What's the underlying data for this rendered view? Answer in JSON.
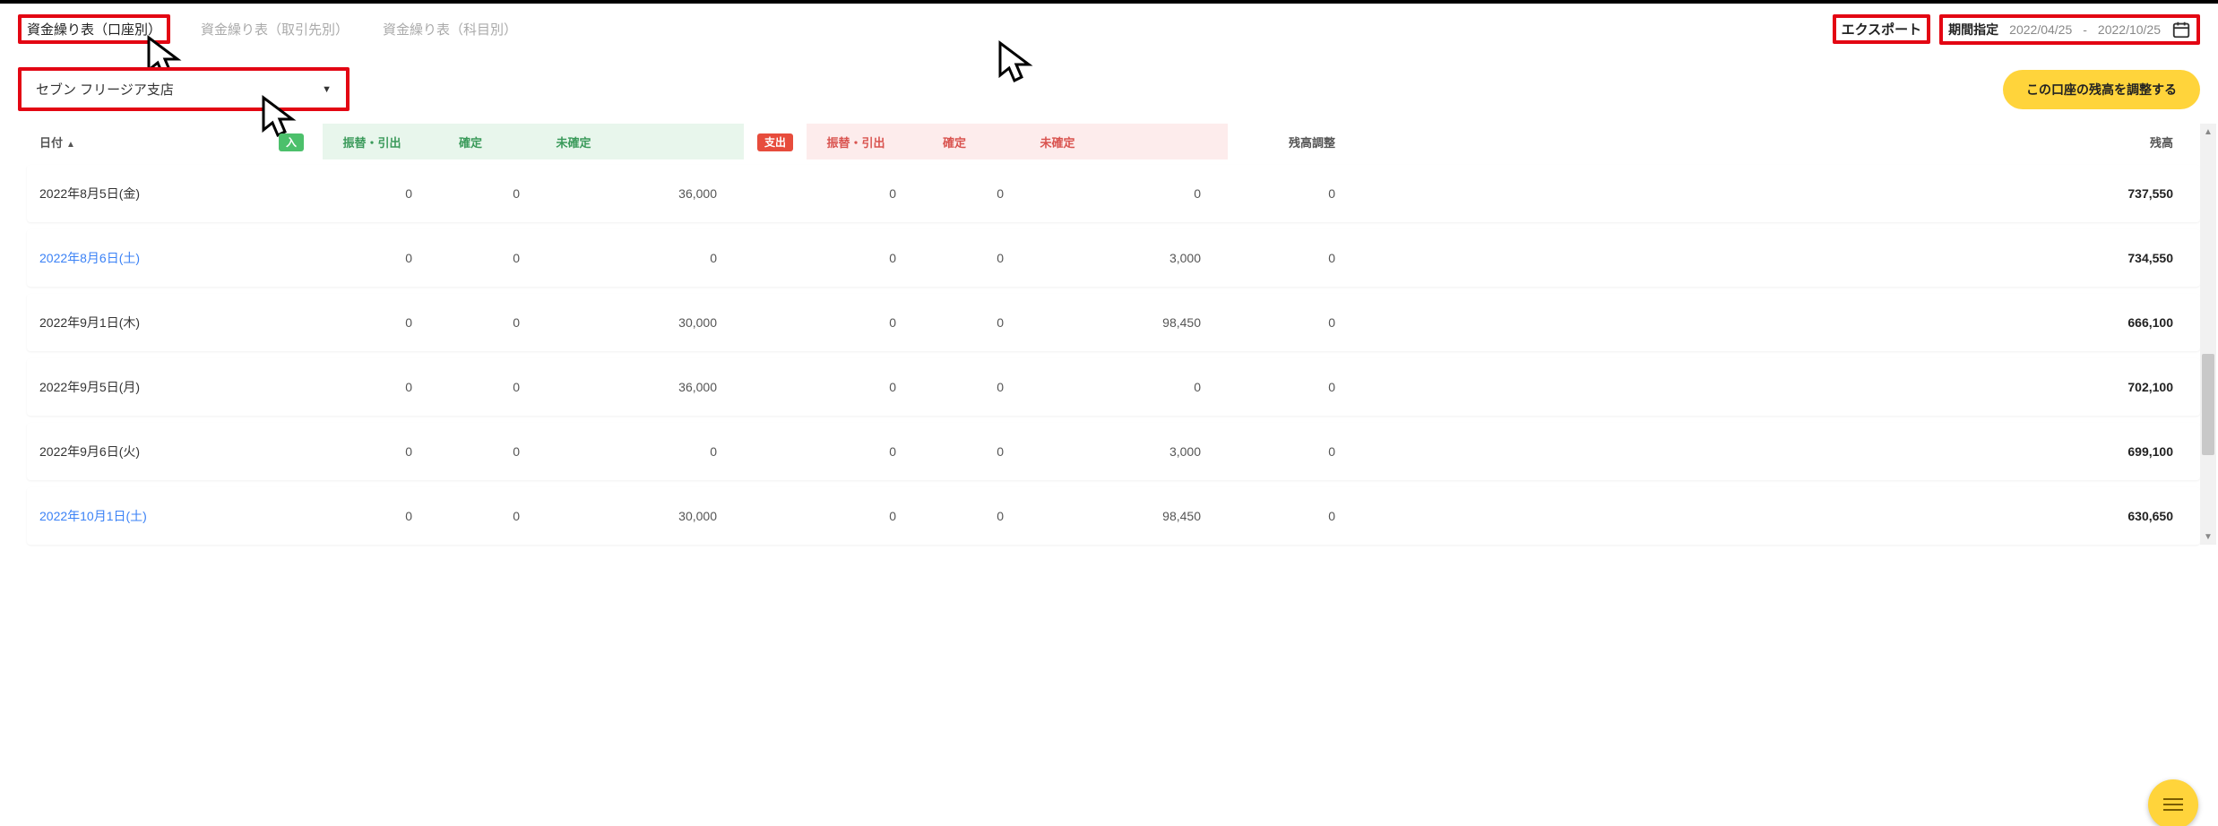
{
  "tabs": {
    "byAccount": "資金繰り表（口座別）",
    "byPartner": "資金繰り表（取引先別）",
    "byItem": "資金繰り表（科目別）"
  },
  "export_label": "エクスポート",
  "period": {
    "label": "期間指定",
    "from": "2022/04/25",
    "sep": "-",
    "to": "2022/10/25"
  },
  "account_selected": "セブン フリージア支店",
  "adjust_balance_label": "この口座の残高を調整する",
  "columns": {
    "date": "日付",
    "badge_in": "入",
    "in_transfer": "振替・引出",
    "in_confirmed": "確定",
    "in_unconfirmed": "未確定",
    "badge_out": "支出",
    "out_transfer": "振替・引出",
    "out_confirmed": "確定",
    "out_unconfirmed": "未確定",
    "adjustment": "残高調整",
    "balance": "残高"
  },
  "rows": [
    {
      "date": "2022年8月5日(金)",
      "link": false,
      "in_t": "0",
      "in_c": "0",
      "in_u": "36,000",
      "out_t": "0",
      "out_c": "0",
      "out_u": "0",
      "adj": "0",
      "bal": "737,550"
    },
    {
      "date": "2022年8月6日(土)",
      "link": true,
      "in_t": "0",
      "in_c": "0",
      "in_u": "0",
      "out_t": "0",
      "out_c": "0",
      "out_u": "3,000",
      "adj": "0",
      "bal": "734,550"
    },
    {
      "date": "2022年9月1日(木)",
      "link": false,
      "in_t": "0",
      "in_c": "0",
      "in_u": "30,000",
      "out_t": "0",
      "out_c": "0",
      "out_u": "98,450",
      "adj": "0",
      "bal": "666,100"
    },
    {
      "date": "2022年9月5日(月)",
      "link": false,
      "in_t": "0",
      "in_c": "0",
      "in_u": "36,000",
      "out_t": "0",
      "out_c": "0",
      "out_u": "0",
      "adj": "0",
      "bal": "702,100"
    },
    {
      "date": "2022年9月6日(火)",
      "link": false,
      "in_t": "0",
      "in_c": "0",
      "in_u": "0",
      "out_t": "0",
      "out_c": "0",
      "out_u": "3,000",
      "adj": "0",
      "bal": "699,100"
    },
    {
      "date": "2022年10月1日(土)",
      "link": true,
      "in_t": "0",
      "in_c": "0",
      "in_u": "30,000",
      "out_t": "0",
      "out_c": "0",
      "out_u": "98,450",
      "adj": "0",
      "bal": "630,650"
    }
  ]
}
